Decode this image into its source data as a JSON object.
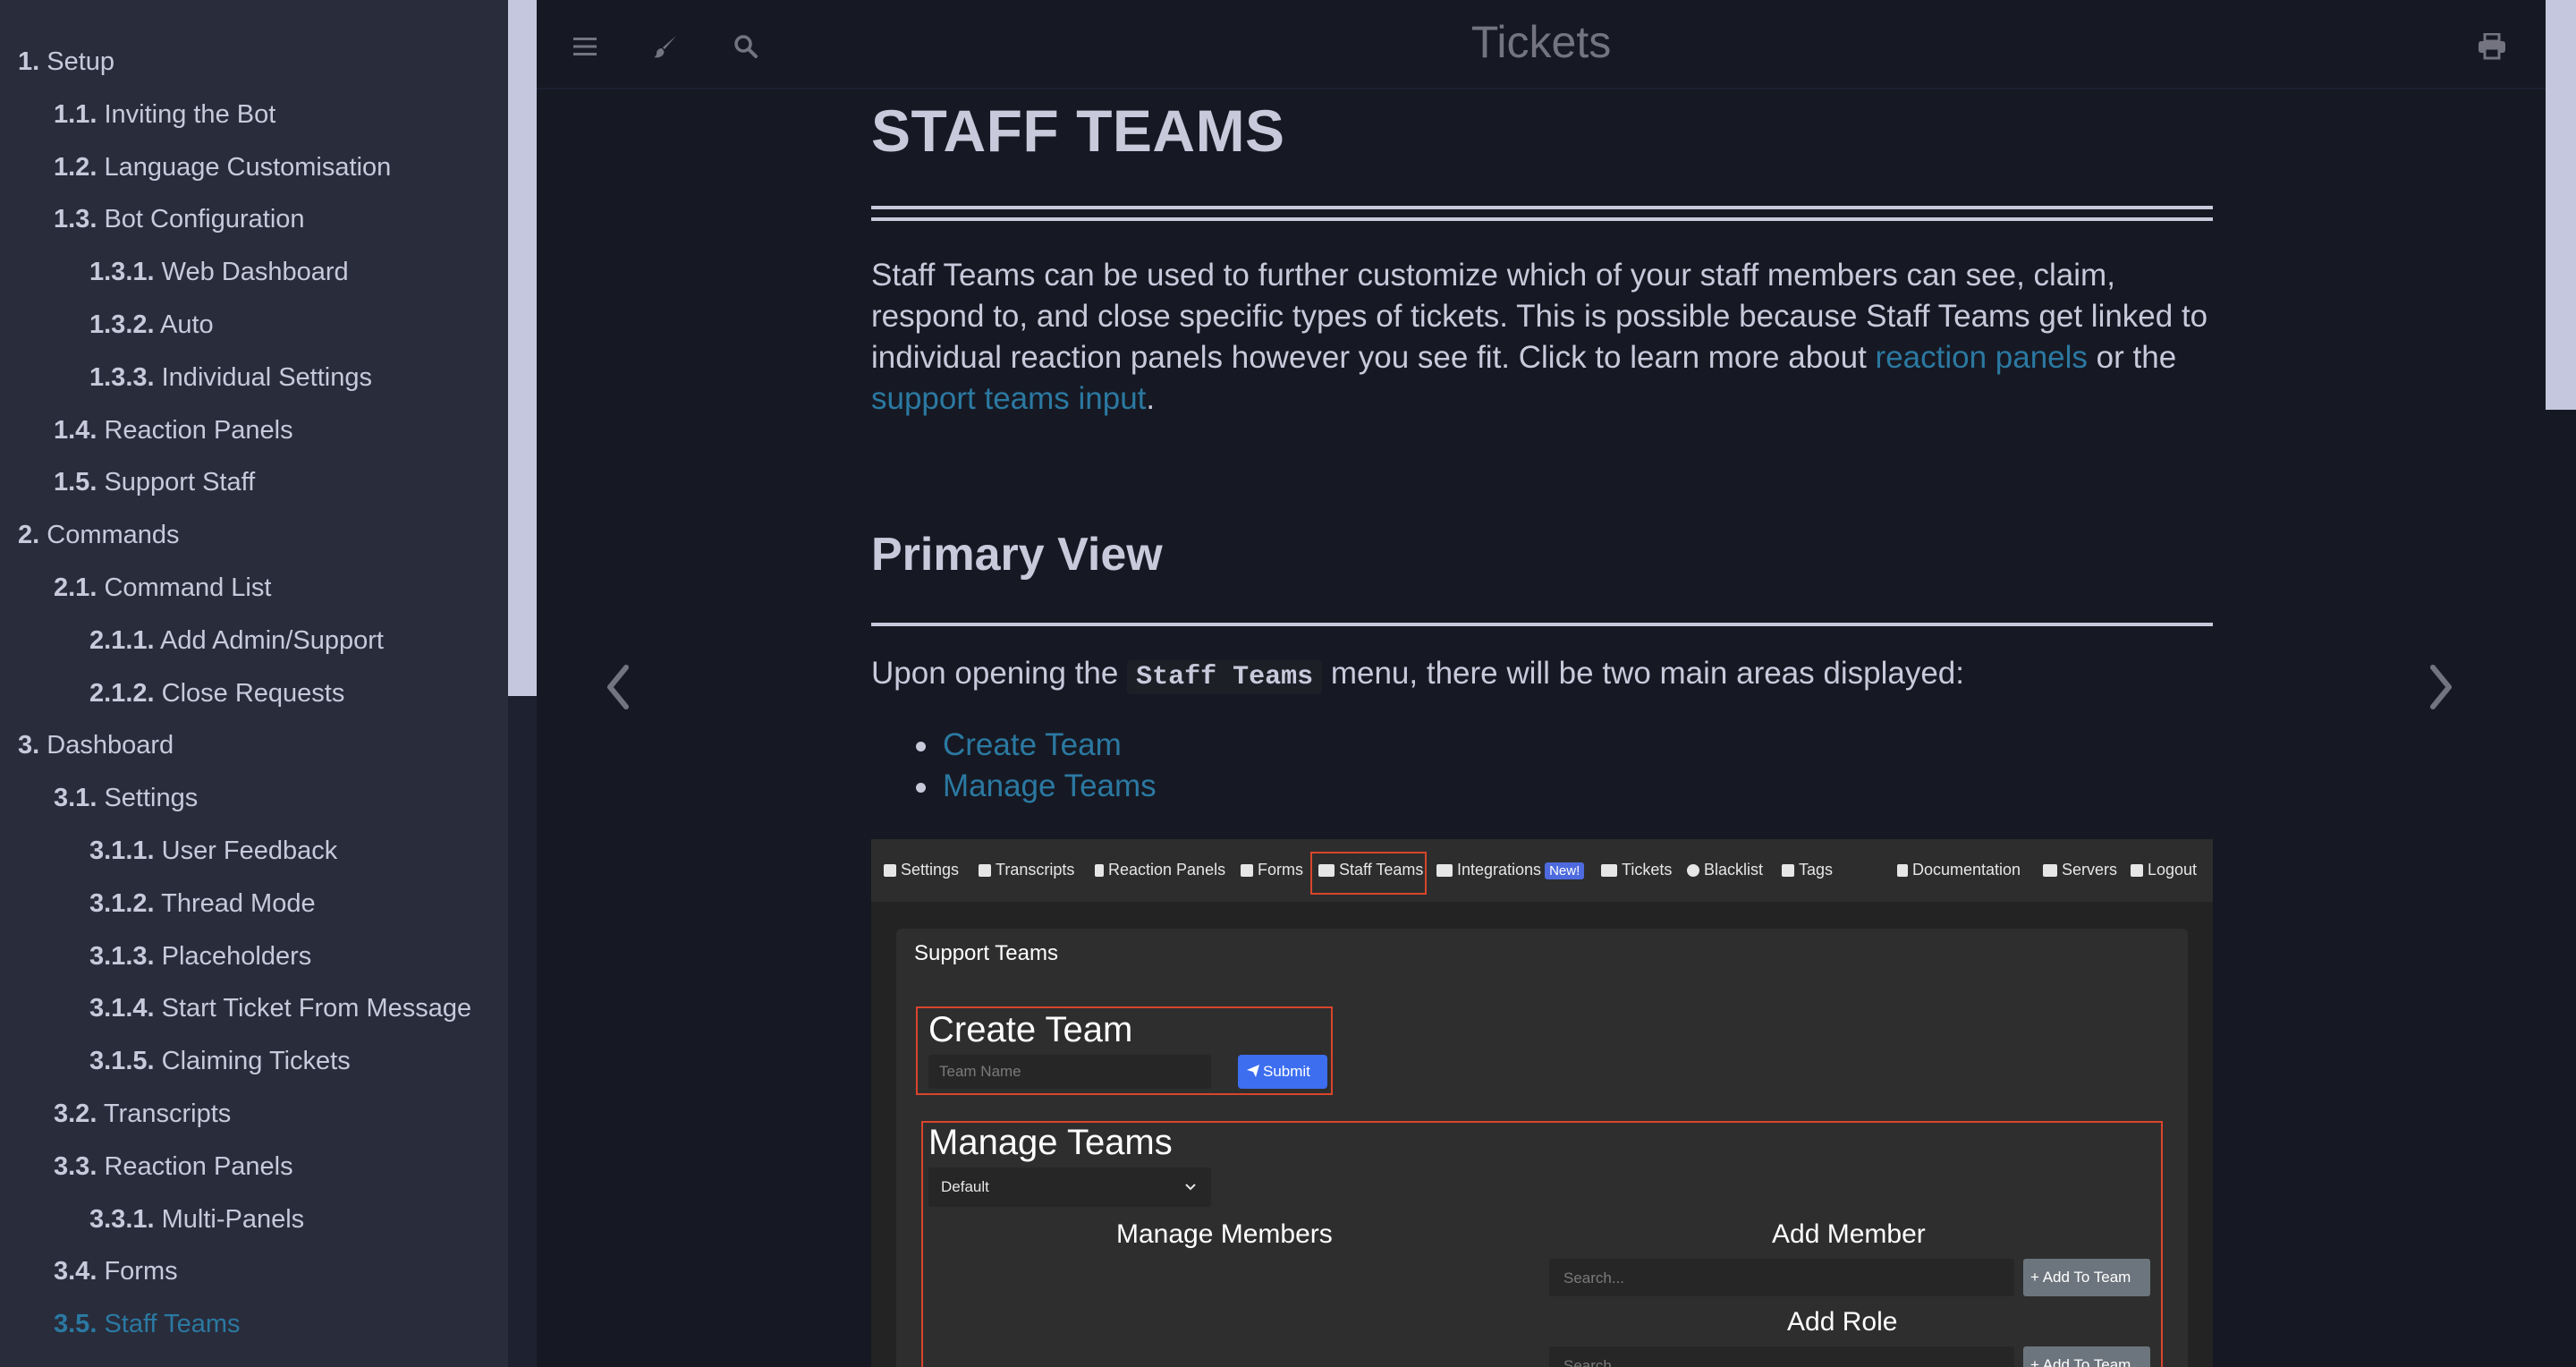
{
  "sidebar": {
    "items": [
      {
        "num": "1.",
        "label": "Setup",
        "level": 0,
        "active": false
      },
      {
        "num": "1.1.",
        "label": "Inviting the Bot",
        "level": 1,
        "active": false
      },
      {
        "num": "1.2.",
        "label": "Language Customisation",
        "level": 1,
        "active": false
      },
      {
        "num": "1.3.",
        "label": "Bot Configuration",
        "level": 1,
        "active": false
      },
      {
        "num": "1.3.1.",
        "label": "Web Dashboard",
        "level": 2,
        "active": false
      },
      {
        "num": "1.3.2.",
        "label": "Auto",
        "level": 2,
        "active": false
      },
      {
        "num": "1.3.3.",
        "label": "Individual Settings",
        "level": 2,
        "active": false
      },
      {
        "num": "1.4.",
        "label": "Reaction Panels",
        "level": 1,
        "active": false
      },
      {
        "num": "1.5.",
        "label": "Support Staff",
        "level": 1,
        "active": false
      },
      {
        "num": "2.",
        "label": "Commands",
        "level": 0,
        "active": false
      },
      {
        "num": "2.1.",
        "label": "Command List",
        "level": 1,
        "active": false
      },
      {
        "num": "2.1.1.",
        "label": "Add Admin/Support",
        "level": 2,
        "active": false
      },
      {
        "num": "2.1.2.",
        "label": "Close Requests",
        "level": 2,
        "active": false
      },
      {
        "num": "3.",
        "label": "Dashboard",
        "level": 0,
        "active": false
      },
      {
        "num": "3.1.",
        "label": "Settings",
        "level": 1,
        "active": false
      },
      {
        "num": "3.1.1.",
        "label": "User Feedback",
        "level": 2,
        "active": false
      },
      {
        "num": "3.1.2.",
        "label": "Thread Mode",
        "level": 2,
        "active": false
      },
      {
        "num": "3.1.3.",
        "label": "Placeholders",
        "level": 2,
        "active": false
      },
      {
        "num": "3.1.4.",
        "label": "Start Ticket From Message",
        "level": 2,
        "active": false
      },
      {
        "num": "3.1.5.",
        "label": "Claiming Tickets",
        "level": 2,
        "active": false
      },
      {
        "num": "3.2.",
        "label": "Transcripts",
        "level": 1,
        "active": false
      },
      {
        "num": "3.3.",
        "label": "Reaction Panels",
        "level": 1,
        "active": false
      },
      {
        "num": "3.3.1.",
        "label": "Multi-Panels",
        "level": 2,
        "active": false
      },
      {
        "num": "3.4.",
        "label": "Forms",
        "level": 1,
        "active": false
      },
      {
        "num": "3.5.",
        "label": "Staff Teams",
        "level": 1,
        "active": true
      }
    ]
  },
  "menubar": {
    "title": "Tickets",
    "icons": [
      "menu-icon",
      "paintbrush-icon",
      "search-icon",
      "print-icon"
    ]
  },
  "content": {
    "h1": "STAFF TEAMS",
    "intro_text_1": "Staff Teams can be used to further customize which of your staff members can see, claim, respond to, and close specific types of tickets. This is possible because Staff Teams get linked to individual reaction panels however you see fit. Click to learn more about ",
    "intro_link_1": "reaction panels",
    "intro_text_2": " or the ",
    "intro_link_2": "support teams input",
    "intro_text_3": ".",
    "h2": "Primary View",
    "p2_before": "Upon opening the ",
    "p2_code": "Staff Teams",
    "p2_after": " menu, there will be two main areas displayed:",
    "bullets": [
      "Create Team",
      "Manage Teams"
    ]
  },
  "screenshot": {
    "nav": {
      "settings": "Settings",
      "transcripts": "Transcripts",
      "reaction_panels": "Reaction Panels",
      "forms": "Forms",
      "staff_teams": "Staff Teams",
      "integrations": "Integrations",
      "new_badge": "New!",
      "tickets": "Tickets",
      "blacklist": "Blacklist",
      "tags": "Tags",
      "documentation": "Documentation",
      "servers": "Servers",
      "logout": "Logout"
    },
    "panel_title": "Support Teams",
    "create_team": {
      "title": "Create Team",
      "placeholder": "Team Name",
      "submit": "Submit"
    },
    "manage_teams": {
      "title": "Manage Teams",
      "selected": "Default",
      "manage_members": "Manage Members",
      "add_member": "Add Member",
      "search_placeholder": "Search...",
      "add_to_team": "+ Add To Team",
      "add_role": "Add Role"
    }
  },
  "colors": {
    "sidebar_bg": "#292c3b",
    "page_bg": "#161923",
    "text": "#c8c9db",
    "link": "#2b79a2",
    "highlight_border": "#d9452b"
  }
}
